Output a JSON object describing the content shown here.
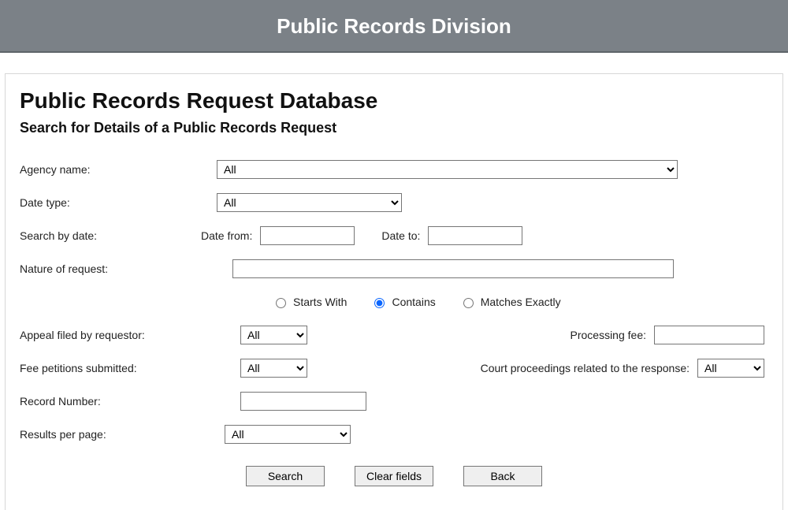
{
  "banner": {
    "title": "Public Records Division"
  },
  "heading1": "Public Records Request Database",
  "heading2": "Search for Details of a Public Records Request",
  "labels": {
    "agency": "Agency name:",
    "dateType": "Date type:",
    "searchByDate": "Search by date:",
    "dateFrom": "Date from:",
    "dateTo": "Date to:",
    "nature": "Nature of request:",
    "appeal": "Appeal filed by requestor:",
    "processingFee": "Processing fee:",
    "feePetitions": "Fee petitions submitted:",
    "courtProceedings": "Court proceedings related to the response:",
    "recordNumber": "Record Number:",
    "resultsPerPage": "Results per page:"
  },
  "selectValues": {
    "agency": "All",
    "dateType": "All",
    "appeal": "All",
    "feePetitions": "All",
    "courtProceedings": "All",
    "resultsPerPage": "All"
  },
  "matchMode": {
    "startsWith": "Starts With",
    "contains": "Contains",
    "matchesExactly": "Matches Exactly",
    "selected": "contains"
  },
  "buttons": {
    "search": "Search",
    "clear": "Clear fields",
    "back": "Back"
  }
}
